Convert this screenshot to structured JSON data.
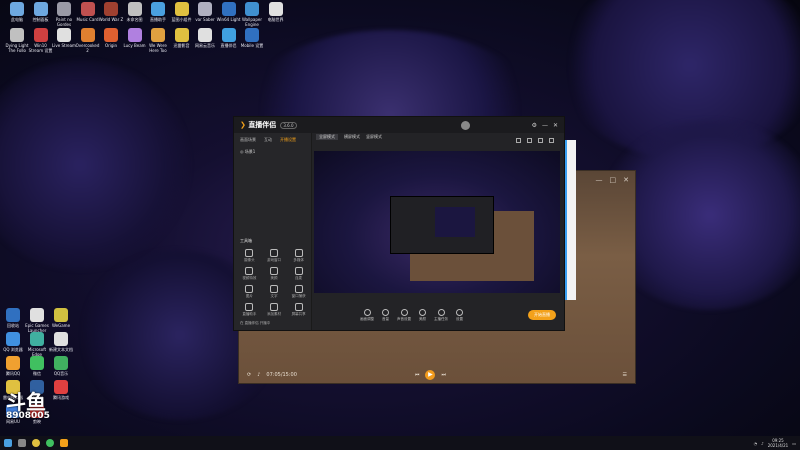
{
  "desktop": {
    "top_row": [
      {
        "label": "此电脑",
        "color": "#6ea8e0"
      },
      {
        "label": "控制面板",
        "color": "#6ea8e0"
      },
      {
        "label": "Paint no Gordes",
        "color": "#9a9aa6"
      },
      {
        "label": "Music Card",
        "color": "#c05050"
      },
      {
        "label": "World War Z",
        "color": "#a04030"
      },
      {
        "label": "未命名图",
        "color": "#c0c0c0"
      },
      {
        "label": "直播助手",
        "color": "#4aa0e0"
      },
      {
        "label": "蓝图小组件",
        "color": "#e0c040"
      },
      {
        "label": "var Saber",
        "color": "#b0b0c0"
      },
      {
        "label": "Win64 Light",
        "color": "#3070c0"
      },
      {
        "label": "Wallpaper Engine",
        "color": "#4090d0"
      },
      {
        "label": "电脑世界",
        "color": "#e0e0e0"
      }
    ],
    "second_row": [
      {
        "label": "Dying Light The Follo",
        "color": "#c0c0c0"
      },
      {
        "label": "Win10 Stream 设置",
        "color": "#d04040"
      },
      {
        "label": "Live Stream",
        "color": "#e0e0e0"
      },
      {
        "label": "Overcooked 2",
        "color": "#e08030"
      },
      {
        "label": "Origin",
        "color": "#e06030"
      },
      {
        "label": "Lucy Beam",
        "color": "#b080e0"
      },
      {
        "label": "We Were Here Too",
        "color": "#e0a040"
      },
      {
        "label": "迅雷影音",
        "color": "#e0c040"
      },
      {
        "label": "网易云音乐",
        "color": "#e0e0e0"
      },
      {
        "label": "直播伴侣",
        "color": "#40a0e0"
      },
      {
        "label": "Mobile 设置",
        "color": "#3070c0"
      }
    ],
    "left_col": [
      {
        "label": "回收站",
        "color": "#3070c0"
      },
      {
        "label": "Epic Games Launcher",
        "color": "#e0e0e0"
      },
      {
        "label": "WeGame",
        "color": "#d0c040"
      },
      {
        "label": "QQ 浏览器",
        "color": "#4090e0"
      },
      {
        "label": "Microsoft Edge",
        "color": "#40b0a0"
      },
      {
        "label": "新建文本文档",
        "color": "#e0e0e0"
      },
      {
        "label": "腾讯QQ",
        "color": "#f0a030"
      },
      {
        "label": "微信",
        "color": "#40c060"
      },
      {
        "label": "QQ音乐",
        "color": "#40b060"
      },
      {
        "label": "雷电模拟器",
        "color": "#e0c040"
      },
      {
        "label": "Steam",
        "color": "#3060a0"
      },
      {
        "label": "腾讯游戏",
        "color": "#e04040"
      },
      {
        "label": "网易UU",
        "color": "#4080e0"
      },
      {
        "label": "剪映",
        "color": "#e03030"
      }
    ]
  },
  "app": {
    "logo": "直播伴侣",
    "version": "3.6.0",
    "left_tabs": [
      "画面场景",
      "互动",
      "开播设置"
    ],
    "scene_label": "场景1",
    "tools_title": "工具箱",
    "tools": [
      "摄像头",
      "游戏窗口",
      "多媒体",
      "视频特效",
      "美颜",
      "连麦",
      "图片",
      "文字",
      "窗口捕获",
      "直播助手",
      "添加素材",
      "屏幕共享"
    ],
    "left_footer": "在 直播伴侣 开播中",
    "preview_tabs": [
      "全屏模式",
      "横屏模式",
      "竖屏模式"
    ],
    "bottom_items": [
      "画面调整",
      "音量",
      "声音设置",
      "美颜",
      "主播任务",
      "设置"
    ],
    "go_live": "开始直播"
  },
  "back_player": {
    "time": "07:05/15:00",
    "controls": [
      "上一个",
      "播放",
      "下一个"
    ]
  },
  "overlay": {
    "big_text": "斗鱼",
    "number": "8908005"
  },
  "taskbar": {
    "time": "09:25",
    "date": "2021/4/21"
  }
}
